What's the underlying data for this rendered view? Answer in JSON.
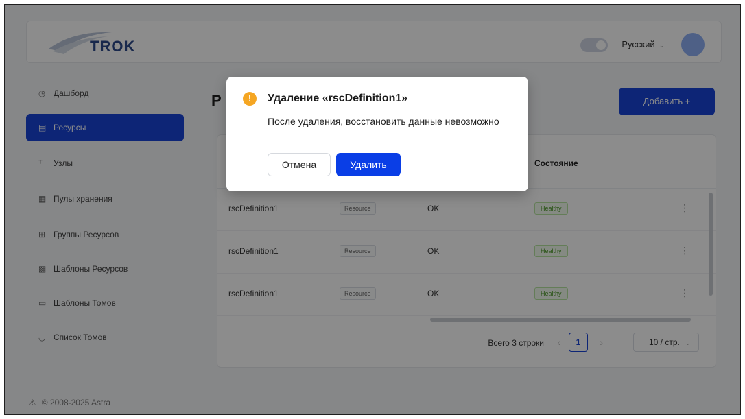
{
  "header": {
    "logo_text": "TROK",
    "language": "Русский",
    "avatar_initial": ""
  },
  "sidebar": {
    "items": [
      {
        "label": "Дашборд",
        "icon": "dashboard-icon",
        "glyph": "◷"
      },
      {
        "label": "Ресурсы",
        "icon": "resources-icon",
        "glyph": "▤"
      },
      {
        "label": "Узлы",
        "icon": "nodes-icon",
        "glyph": "⸆"
      },
      {
        "label": "Пулы хранения",
        "icon": "storage-pool-icon",
        "glyph": "▦"
      },
      {
        "label": "Группы Ресурсов",
        "icon": "resource-groups-icon",
        "glyph": "⊞"
      },
      {
        "label": "Шаблоны Ресурсов",
        "icon": "resource-templates-icon",
        "glyph": "▩"
      },
      {
        "label": "Шаблоны Томов",
        "icon": "volume-templates-icon",
        "glyph": "▭"
      },
      {
        "label": "Список Томов",
        "icon": "volume-list-icon",
        "glyph": "◡"
      }
    ],
    "active_index": 1,
    "copyright": "© 2008-2025 Astra"
  },
  "main": {
    "title": "Р",
    "add_button": "Добавить +",
    "table": {
      "headers": [
        "Состояние"
      ],
      "rows": [
        {
          "name": "rscDefinition1",
          "tag": "Resource",
          "status": "OK",
          "state": "Healthy"
        },
        {
          "name": "rscDefinition1",
          "tag": "Resource",
          "status": "OK",
          "state": "Healthy"
        },
        {
          "name": "rscDefinition1",
          "tag": "Resource",
          "status": "OK",
          "state": "Healthy"
        }
      ]
    },
    "pagination": {
      "total": "Всего 3 строки",
      "current_page": "1",
      "page_size": "10 / стр."
    }
  },
  "modal": {
    "title": "Удаление «rscDefinition1»",
    "text": "После удаления, восстановить данные невозможно",
    "cancel_label": "Отмена",
    "delete_label": "Удалить",
    "icon": "warning-icon",
    "icon_glyph": "!"
  },
  "colors": {
    "primary": "#0a3ee6",
    "warning": "#f5a623"
  }
}
